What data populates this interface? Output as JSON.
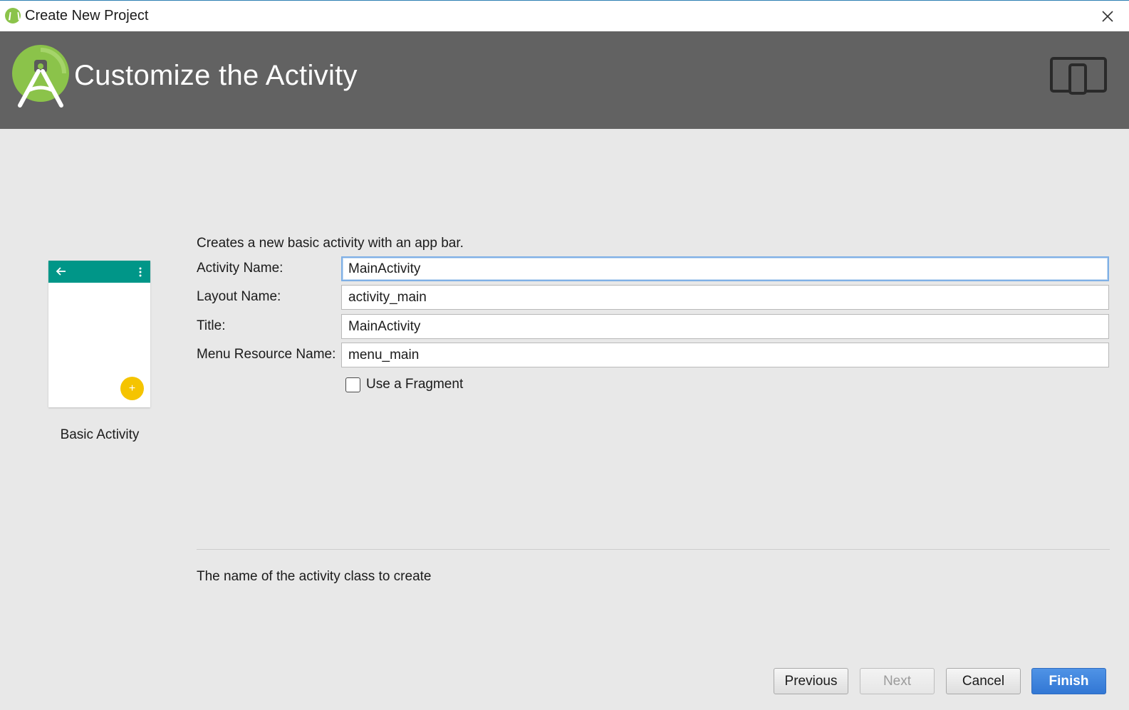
{
  "window": {
    "title": "Create New Project",
    "app_icon": "android-studio-icon",
    "close_icon": "close-icon"
  },
  "header": {
    "heading": "Customize the Activity",
    "logo_icon": "android-studio-logo-icon",
    "device_icon": "tablet-phone-icon"
  },
  "preview": {
    "template_name": "Basic Activity",
    "app_bar_color": "#009688",
    "fab_color": "#f5c400",
    "fab_symbol": "+"
  },
  "form": {
    "description": "Creates a new basic activity with an app bar.",
    "fields": [
      {
        "label": "Activity Name:",
        "value": "MainActivity"
      },
      {
        "label": "Layout Name:",
        "value": "activity_main"
      },
      {
        "label": "Title:",
        "value": "MainActivity"
      },
      {
        "label": "Menu Resource Name:",
        "value": "menu_main"
      }
    ],
    "use_fragment": {
      "label": "Use a Fragment",
      "checked": false
    }
  },
  "help_text": "The name of the activity class to create",
  "buttons": {
    "previous": "Previous",
    "next": "Next",
    "cancel": "Cancel",
    "finish": "Finish"
  },
  "colors": {
    "header_bg": "#626262",
    "finish_button": "#3d84dc",
    "focus_border": "#7fb0e6"
  }
}
